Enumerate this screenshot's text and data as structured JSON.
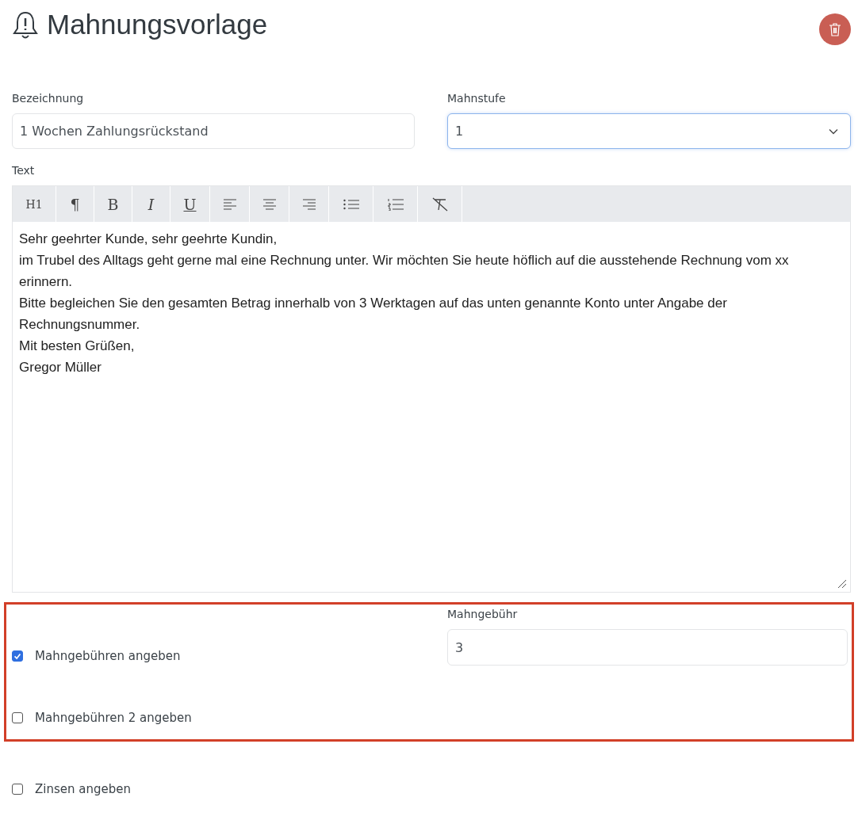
{
  "page": {
    "title": "Mahnungsvorlage"
  },
  "fields": {
    "bezeichnung": {
      "label": "Bezeichnung",
      "value": "1 Wochen Zahlungsrückstand"
    },
    "mahnstufe": {
      "label": "Mahnstufe",
      "value": "1"
    }
  },
  "editor": {
    "label": "Text",
    "toolbar": [
      {
        "kind": "heading",
        "label": "H1"
      },
      {
        "kind": "paragraph",
        "label": "¶"
      },
      {
        "kind": "bold",
        "label": "B"
      },
      {
        "kind": "italic",
        "label": "I"
      },
      {
        "kind": "underline",
        "label": "U"
      },
      {
        "kind": "align-left"
      },
      {
        "kind": "align-center"
      },
      {
        "kind": "align-right"
      },
      {
        "kind": "bullet-list"
      },
      {
        "kind": "numbered-list"
      },
      {
        "kind": "clear-format"
      }
    ],
    "lines": [
      "Sehr geehrter Kunde, sehr geehrte Kundin,",
      "im Trubel des Alltags geht gerne mal eine Rechnung unter. Wir möchten Sie heute höflich auf die ausstehende Rechnung vom xx erinnern.",
      "Bitte begleichen Sie den gesamten Betrag innerhalb von 3 Werktagen auf das unten genannte Konto unter Angabe der Rechnungsnummer.",
      "Mit besten Grüßen,",
      "Gregor Müller"
    ]
  },
  "fees": {
    "highlighted": true,
    "fee1": {
      "label": "Mahngebühren angeben",
      "checked": true
    },
    "amount": {
      "label": "Mahngebühr",
      "value": "3"
    },
    "fee2": {
      "label": "Mahngebühren 2 angeben",
      "checked": false
    }
  },
  "interest": {
    "label": "Zinsen angeben",
    "checked": false
  }
}
